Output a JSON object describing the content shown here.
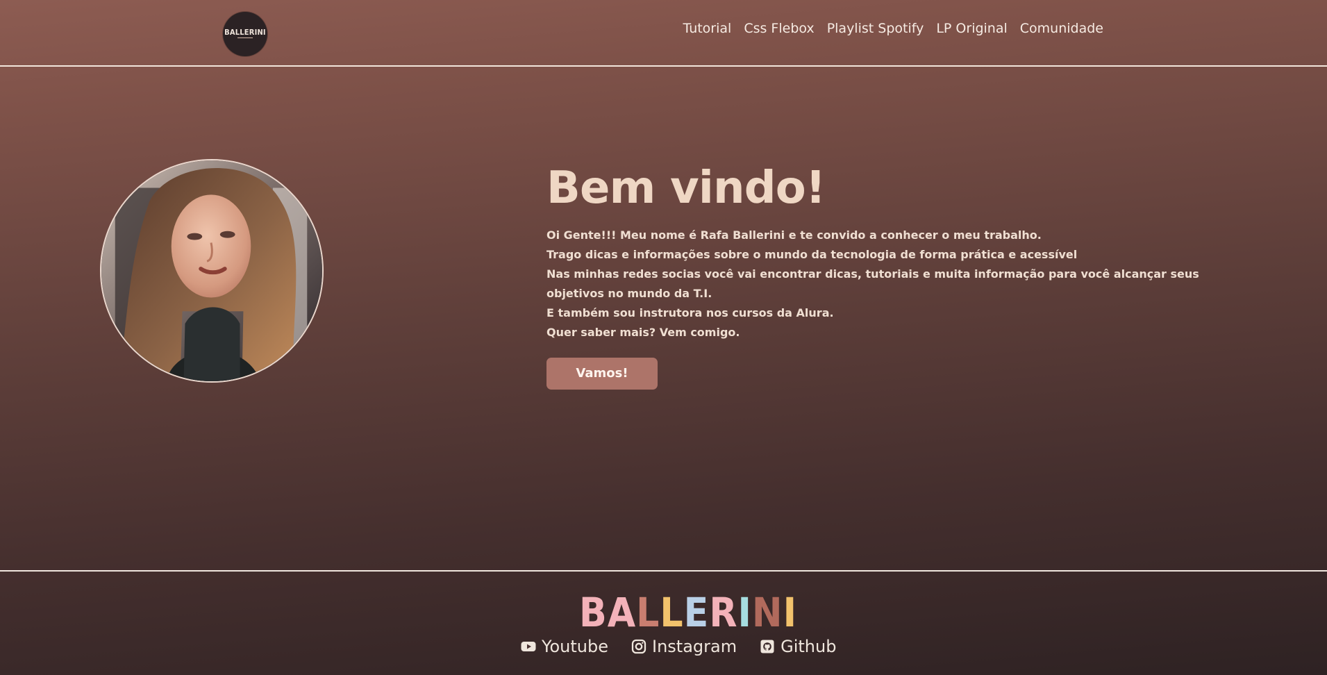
{
  "header": {
    "logo": {
      "text": "BALLERINI"
    },
    "nav": [
      "Tutorial",
      "Css Flebox",
      "Playlist Spotify",
      "LP Original",
      "Comunidade"
    ]
  },
  "hero": {
    "title": "Bem vindo!",
    "lines": [
      "Oi Gente!!! Meu nome é Rafa Ballerini e te convido a conhecer o meu trabalho.",
      "Trago dicas e informações sobre o mundo da tecnologia de forma prática e acessível",
      "Nas minhas redes socias você vai encontrar dicas, tutoriais e muita informação para você alcançar seus objetivos no mundo da T.I.",
      "E também sou instrutora nos cursos da Alura.",
      "Quer saber mais? Vem comigo."
    ],
    "cta_label": "Vamos!"
  },
  "footer": {
    "brand_letters": [
      {
        "char": "B",
        "color": "#f3b2b9"
      },
      {
        "char": "A",
        "color": "#f3b2b9"
      },
      {
        "char": "L",
        "color": "#c97e70"
      },
      {
        "char": "L",
        "color": "#f2c26c"
      },
      {
        "char": "E",
        "color": "#b9d0e7"
      },
      {
        "char": "R",
        "color": "#f3b2b9"
      },
      {
        "char": "I",
        "color": "#a6dde0"
      },
      {
        "char": "N",
        "color": "#b16a5c"
      },
      {
        "char": "I",
        "color": "#f2c26c"
      }
    ],
    "social_links": [
      {
        "label": "Youtube",
        "icon": "youtube-icon"
      },
      {
        "label": "Instagram",
        "icon": "instagram-icon"
      },
      {
        "label": "Github",
        "icon": "github-icon"
      }
    ]
  }
}
